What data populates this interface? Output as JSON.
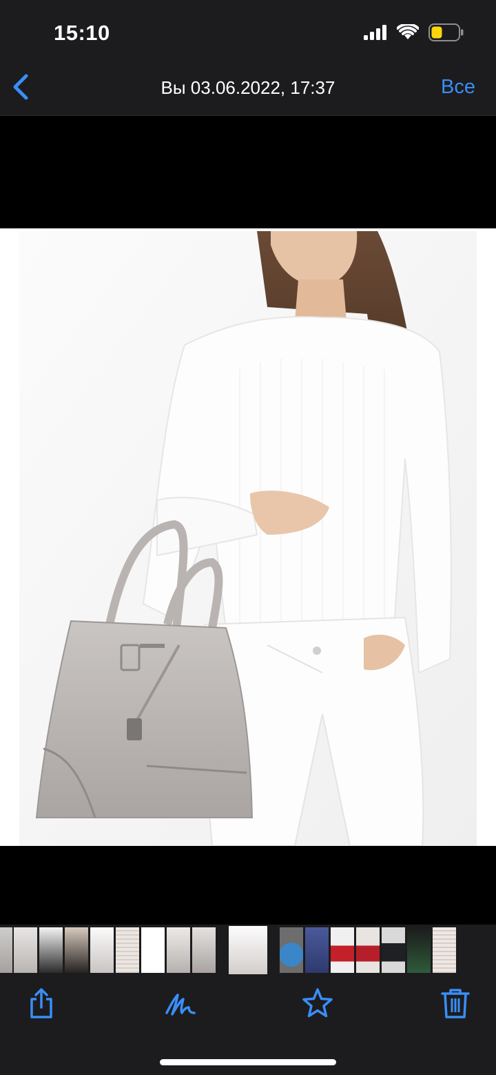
{
  "status_bar": {
    "time": "15:10",
    "icons": [
      "signal-icon",
      "wifi-icon",
      "battery-icon"
    ],
    "battery_color": "#ffd60a"
  },
  "nav": {
    "title": "Вы 03.06.2022, 17:37",
    "back_icon": "chevron-left-icon",
    "all_label": "Все",
    "accent_color": "#3a8ef6"
  },
  "photo": {
    "subject": "woman-in-white-holding-grey-tote-bag"
  },
  "thumbnails": {
    "count": 18
  },
  "toolbar": {
    "icons": [
      "share-icon",
      "markup-icon",
      "favorite-star-icon",
      "trash-icon"
    ]
  }
}
